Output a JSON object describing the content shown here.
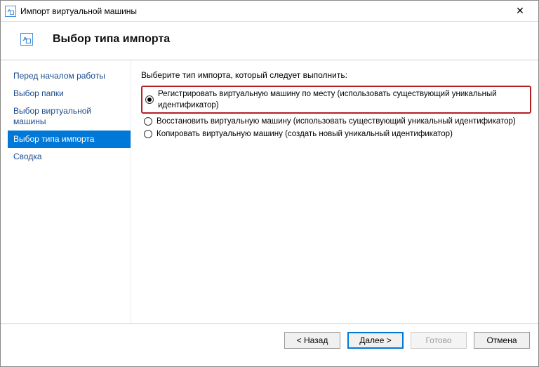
{
  "window": {
    "title": "Импорт виртуальной машины"
  },
  "header": {
    "title": "Выбор типа импорта"
  },
  "sidebar": {
    "items": [
      {
        "label": "Перед началом работы"
      },
      {
        "label": "Выбор папки"
      },
      {
        "label": "Выбор виртуальной машины"
      },
      {
        "label": "Выбор типа импорта"
      },
      {
        "label": "Сводка"
      }
    ],
    "selectedIndex": 3
  },
  "main": {
    "instruction": "Выберите тип импорта, который следует выполнить:",
    "options": [
      {
        "label": "Регистрировать виртуальную машину по месту (использовать существующий уникальный идентификатор)",
        "checked": true,
        "highlight": true
      },
      {
        "label": "Восстановить виртуальную машину (использовать существующий уникальный идентификатор)",
        "checked": false,
        "highlight": false
      },
      {
        "label": "Копировать виртуальную машину (создать новый уникальный идентификатор)",
        "checked": false,
        "highlight": false
      }
    ]
  },
  "footer": {
    "back": "< Назад",
    "next": "Далее >",
    "finish": "Готово",
    "cancel": "Отмена"
  }
}
